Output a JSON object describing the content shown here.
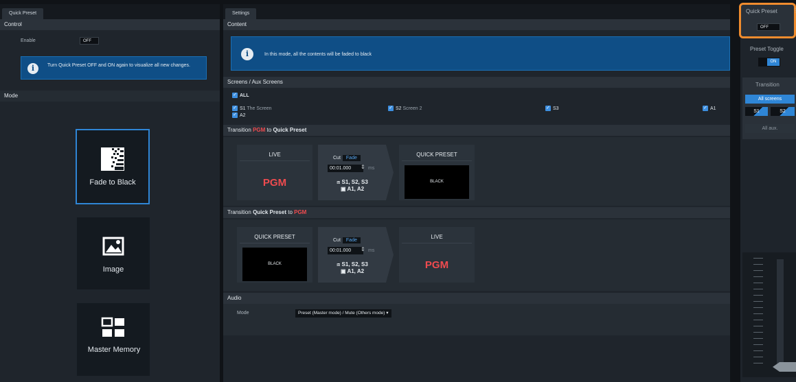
{
  "left": {
    "tab": "Quick Preset",
    "control_title": "Control",
    "enable_label": "Enable",
    "enable_value": "OFF",
    "info_text": "Turn Quick Preset OFF and ON again to visualize all new changes.",
    "mode_title": "Mode",
    "modes": [
      {
        "label": "Fade to Black",
        "icon": "fade-icon",
        "selected": true
      },
      {
        "label": "Image",
        "icon": "image-icon",
        "selected": false
      },
      {
        "label": "Master Memory",
        "icon": "grid-icon",
        "selected": false
      }
    ]
  },
  "settings": {
    "tab": "Settings",
    "content_title": "Content",
    "content_info": "In this mode, all the contents will be faded to black",
    "screens_title": "Screens / Aux Screens",
    "all_label": "ALL",
    "screens": [
      {
        "id": "S1",
        "name": "The Screen"
      },
      {
        "id": "S2",
        "name": "Screen 2"
      },
      {
        "id": "S3",
        "name": ""
      },
      {
        "id": "A1",
        "name": ""
      },
      {
        "id": "A2",
        "name": ""
      }
    ],
    "transition1": {
      "title_prefix": "Transition",
      "title_red": "PGM",
      "title_mid": "to",
      "title_bold": "Quick Preset",
      "left_title": "LIVE",
      "left_content": "PGM",
      "cut": "Cut",
      "fade": "Fade",
      "duration": "00:01.000",
      "ms": "ms",
      "screens_line": "S1, S2, S3",
      "aux_line": "A1, A2",
      "right_title": "QUICK PRESET",
      "right_content": "BLACK"
    },
    "transition2": {
      "title_prefix": "Transition",
      "title_bold": "Quick Preset",
      "title_mid": "to",
      "title_red": "PGM",
      "left_title": "QUICK PRESET",
      "left_content": "BLACK",
      "cut": "Cut",
      "fade": "Fade",
      "duration": "00:01.000",
      "ms": "ms",
      "screens_line": "S1, S2, S3",
      "aux_line": "A1, A2",
      "right_title": "LIVE",
      "right_content": "PGM"
    },
    "audio_title": "Audio",
    "audio_mode_label": "Mode",
    "audio_mode_value": "Preset (Master mode) / Mute (Others mode)"
  },
  "right": {
    "title": "Quick Preset",
    "off": "OFF",
    "preset_toggle": "Preset Toggle",
    "on": "ON",
    "transition": "Transition",
    "all_screens": "All screens",
    "s1": "S1",
    "s2": "S2",
    "all_aux": "All aux."
  },
  "colors": {
    "accent": "#2f86d6",
    "pgm_red": "#ef4b4f",
    "highlight": "#f08c2e"
  }
}
